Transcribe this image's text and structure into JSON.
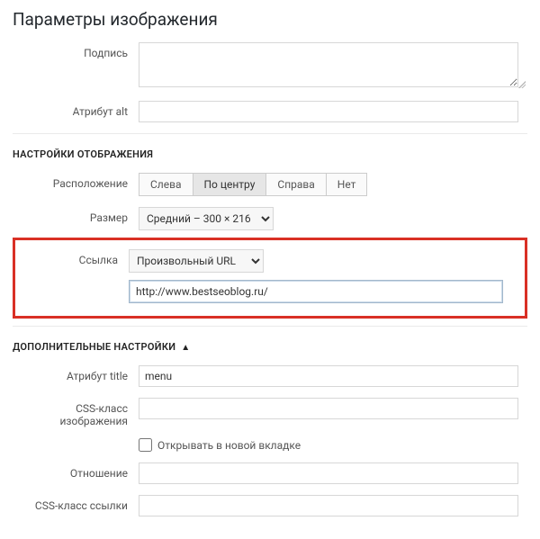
{
  "panel": {
    "title": "Параметры изображения"
  },
  "fields": {
    "caption": {
      "label": "Подпись",
      "value": ""
    },
    "alt": {
      "label": "Атрибут alt",
      "value": ""
    }
  },
  "display": {
    "title": "НАСТРОЙКИ ОТОБРАЖЕНИЯ",
    "align": {
      "label": "Расположение",
      "options": {
        "left": "Слева",
        "center": "По центру",
        "right": "Справа",
        "none": "Нет"
      },
      "selected": "center"
    },
    "size": {
      "label": "Размер",
      "selected": "Средний – 300 × 216"
    },
    "link": {
      "label": "Ссылка",
      "type_selected": "Произвольный URL",
      "url": "http://www.bestseoblog.ru/"
    }
  },
  "advanced": {
    "title": "ДОПОЛНИТЕЛЬНЫЕ НАСТРОЙКИ",
    "title_attr": {
      "label": "Атрибут title",
      "value": "menu"
    },
    "img_css": {
      "label": "CSS-класс изображения",
      "value": ""
    },
    "new_tab": {
      "label": "Открывать в новой вкладке",
      "checked": false
    },
    "rel": {
      "label": "Отношение",
      "value": ""
    },
    "link_css": {
      "label": "CSS-класс ссылки",
      "value": ""
    }
  }
}
